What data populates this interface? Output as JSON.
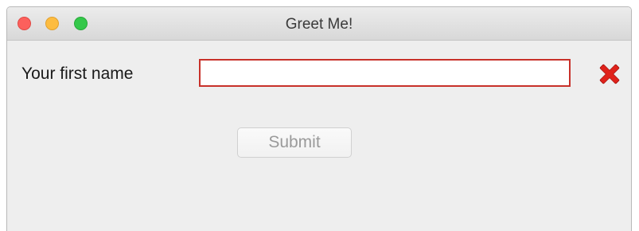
{
  "window": {
    "title": "Greet Me!"
  },
  "form": {
    "first_name_label": "Your first name",
    "first_name_value": "",
    "submit_label": "Submit",
    "submit_disabled": true,
    "validation_state": "error",
    "error_icon": "red-x-icon"
  },
  "colors": {
    "error_border": "#c8312a",
    "error_icon": "#e0221b",
    "close_button": "#fc605c",
    "minimize_button": "#fdbc40",
    "maximize_button": "#34c84a"
  }
}
